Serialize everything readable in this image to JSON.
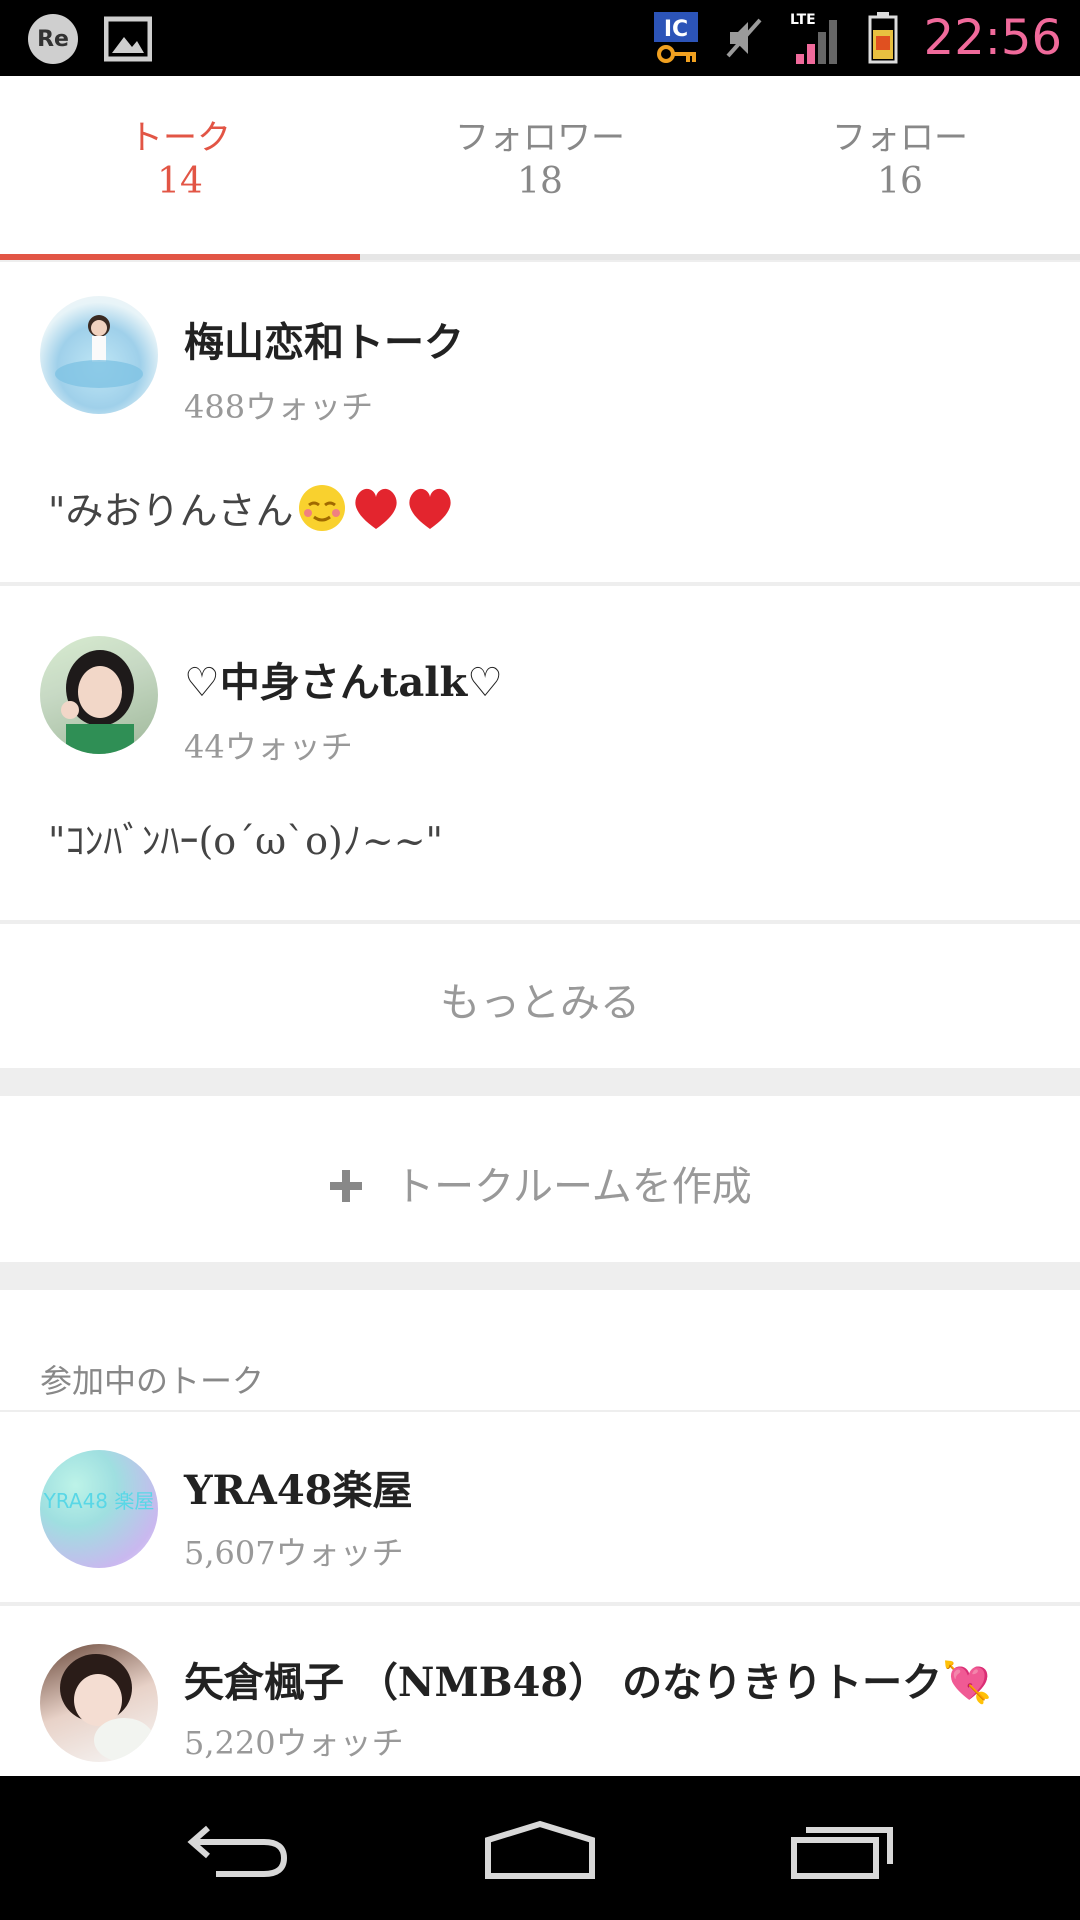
{
  "status_bar": {
    "left_icons": [
      "re-icon",
      "image-icon"
    ],
    "re_label": "Re",
    "right_icons": [
      "ic-key-icon",
      "mute-icon",
      "lte-signal-icon",
      "battery-icon"
    ],
    "network_label": "LTE",
    "ic_label": "IC",
    "time": "22:56"
  },
  "tabs": [
    {
      "label": "トーク",
      "count": "14",
      "active": true
    },
    {
      "label": "フォロワー",
      "count": "18",
      "active": false
    },
    {
      "label": "フォロー",
      "count": "16",
      "active": false
    }
  ],
  "my_talks": [
    {
      "title": "梅山恋和トーク",
      "watch": "488ウォッチ",
      "message": "\"みおりんさん",
      "emoji": [
        "blush-face-emoji",
        "heart-emoji",
        "heart-emoji"
      ]
    },
    {
      "title": "♡中身さんtalk♡",
      "watch": "44ウォッチ",
      "message": "\"ｺﾝﾊﾞﾝﾊｰ(o´ω`o)ﾉ~~\""
    }
  ],
  "more_label": "もっとみる",
  "create_label": "トークルームを作成",
  "joined_section": {
    "title": "参加中のトーク",
    "items": [
      {
        "title": "YRA48楽屋",
        "watch": "5,607ウォッチ",
        "avatar_text": "YRA48 楽屋"
      },
      {
        "title": "矢倉楓子 （NMB48） のなりきりトーク💘",
        "watch": "5,220ウォッチ"
      }
    ]
  },
  "nav_bar": [
    "back-icon",
    "home-icon",
    "recents-icon"
  ]
}
